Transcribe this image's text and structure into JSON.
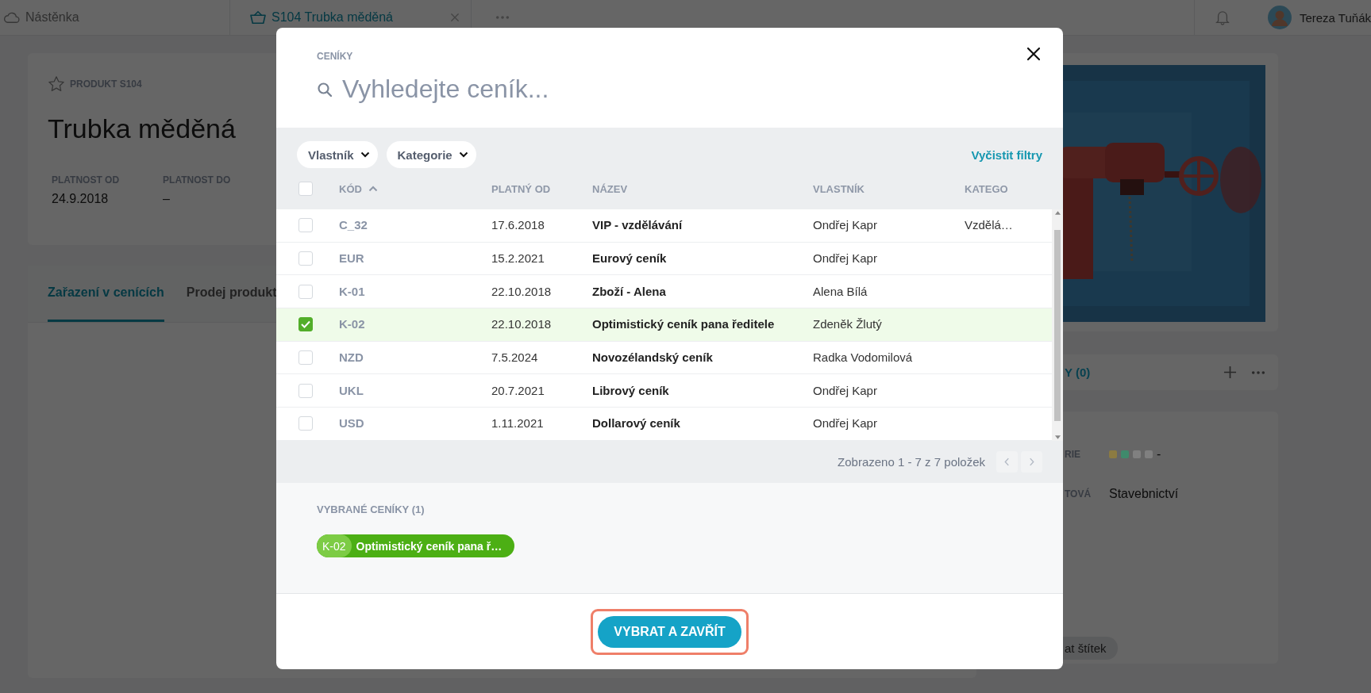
{
  "topbar": {
    "tabs": [
      {
        "label": "Nástěnka",
        "selected": false,
        "closable": false
      },
      {
        "label": "S104 Trubka měděná",
        "selected": true,
        "closable": true
      }
    ],
    "user": {
      "name": "Tereza Tuňák"
    }
  },
  "product": {
    "label": "PRODUKT S104",
    "title": "Trubka měděná",
    "fields": [
      {
        "label": "PLATNOST OD",
        "value": "24.9.2018"
      },
      {
        "label": "PLATNOST DO",
        "value": "–"
      }
    ]
  },
  "product_tabs": [
    {
      "label": "Zařazení v cenících",
      "selected": true
    },
    {
      "label": "Prodej produkt",
      "selected": false
    }
  ],
  "side": {
    "section": {
      "title": "Y (0)"
    },
    "details": [
      {
        "label": "RIE",
        "kind": "swatches",
        "swatches": [
          {
            "color": "#8c7b42"
          },
          {
            "color": "#3f8a6c"
          },
          {
            "color": "#808080"
          },
          {
            "color": "#808080"
          }
        ],
        "value": "-"
      },
      {
        "label": "TOVÁ",
        "kind": "text",
        "value": "Stavebnictví"
      }
    ],
    "tag": "at štítek"
  },
  "modal": {
    "title": "CENÍKY",
    "search": {
      "placeholder": "Vyhledejte ceník..."
    },
    "filters": [
      {
        "label": "Vlastník"
      },
      {
        "label": "Kategorie"
      }
    ],
    "clear": "Vyčistit filtry",
    "select_all": {
      "checked": false
    },
    "columns": [
      {
        "label": "KÓD",
        "sorted": true
      },
      {
        "label": "PLATNÝ OD"
      },
      {
        "label": "NÁZEV"
      },
      {
        "label": "VLASTNÍK"
      },
      {
        "label": "KATEGO"
      }
    ],
    "rows": [
      {
        "code": "C_32",
        "valid_from": "17.6.2018",
        "name": "VIP - vzdělávání",
        "owner": "Ondřej Kapr",
        "category": "Vzdělá…",
        "checked": false,
        "selected": false
      },
      {
        "code": "EUR",
        "valid_from": "15.2.2021",
        "name": "Eurový ceník",
        "owner": "Ondřej Kapr",
        "checked": false,
        "selected": false
      },
      {
        "code": "K-01",
        "valid_from": "22.10.2018",
        "name": "Zboží - Alena",
        "owner": "Alena Bílá",
        "checked": false,
        "selected": false
      },
      {
        "code": "K-02",
        "valid_from": "22.10.2018",
        "name": "Optimistický ceník pana ředitele",
        "owner": "Zdeněk Žlutý",
        "checked": true,
        "selected": true
      },
      {
        "code": "NZD",
        "valid_from": "7.5.2024",
        "name": "Novozélandský ceník",
        "owner": "Radka Vodomilová",
        "checked": false,
        "selected": false
      },
      {
        "code": "UKL",
        "valid_from": "20.7.2021",
        "name": "Librový ceník",
        "owner": "Ondřej Kapr",
        "checked": false,
        "selected": false
      },
      {
        "code": "USD",
        "valid_from": "1.11.2021",
        "name": "Dollarový ceník",
        "owner": "Ondřej Kapr",
        "checked": false,
        "selected": false
      }
    ],
    "pagination": {
      "text": "Zobrazeno 1 - 7 z 7 položek",
      "prev_disabled": true,
      "next_disabled": true
    },
    "selected_title": "VYBRANÉ CENÍKY (1)",
    "chips": [
      {
        "code": "K-02",
        "label": "Optimistický ceník pana ř…"
      }
    ],
    "confirm": {
      "label": "VYBRAT A ZAVŘÍT",
      "highlighted": true
    }
  }
}
